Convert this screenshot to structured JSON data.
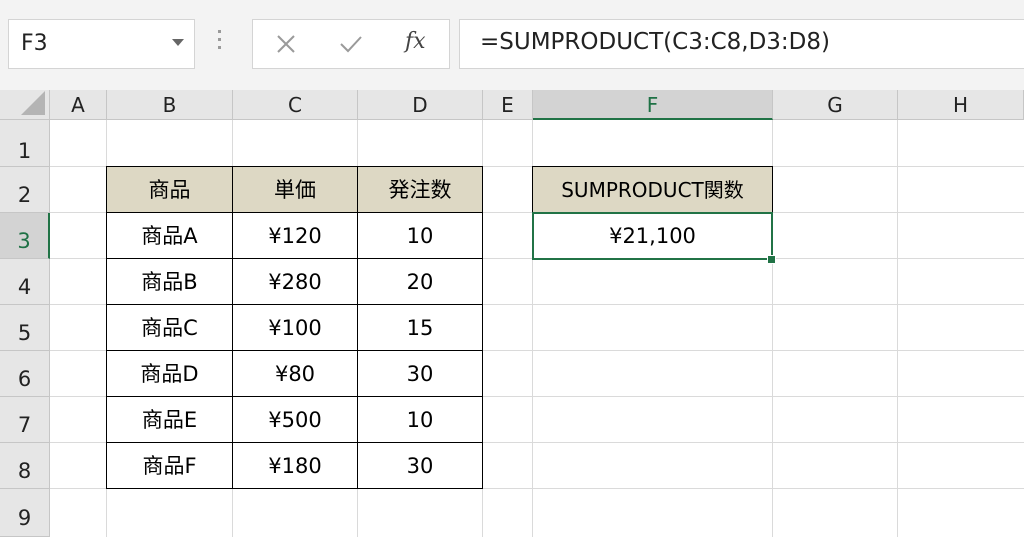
{
  "name_box": {
    "value": "F3"
  },
  "formula_bar": {
    "cancel_icon": "x-icon",
    "enter_icon": "check-icon",
    "fx_label": "fx",
    "formula": "=SUMPRODUCT(C3:C8,D3:D8)"
  },
  "columns": [
    "A",
    "B",
    "C",
    "D",
    "E",
    "F",
    "G",
    "H"
  ],
  "rows": [
    "1",
    "2",
    "3",
    "4",
    "5",
    "6",
    "7",
    "8",
    "9"
  ],
  "table": {
    "headers": [
      "商品",
      "単価",
      "発注数"
    ],
    "rows": [
      [
        "商品A",
        "¥120",
        "10"
      ],
      [
        "商品B",
        "¥280",
        "20"
      ],
      [
        "商品C",
        "¥100",
        "15"
      ],
      [
        "商品D",
        "¥80",
        "30"
      ],
      [
        "商品E",
        "¥500",
        "10"
      ],
      [
        "商品F",
        "¥180",
        "30"
      ]
    ]
  },
  "result": {
    "header": "SUMPRODUCT関数",
    "value": "¥21,100"
  },
  "colors": {
    "header_fill": "#ddd8c4",
    "selection": "#217346"
  }
}
